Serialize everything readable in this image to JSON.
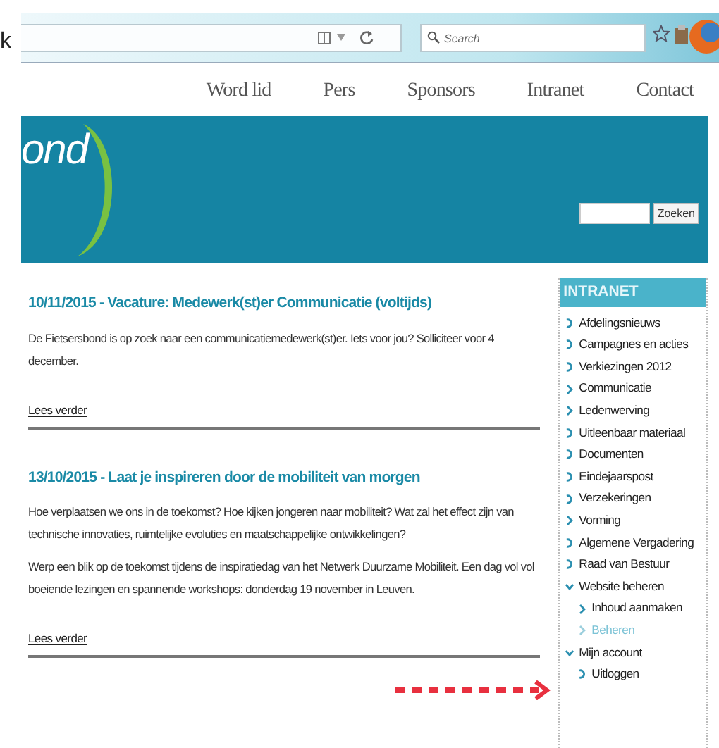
{
  "browser": {
    "edge_text": "k",
    "search": {
      "placeholder": "Search"
    }
  },
  "nav": [
    {
      "label": "Word lid"
    },
    {
      "label": "Pers"
    },
    {
      "label": "Sponsors"
    },
    {
      "label": "Intranet"
    },
    {
      "label": "Contact"
    }
  ],
  "header": {
    "logo_text": "ond",
    "search_button": "Zoeken"
  },
  "articles": [
    {
      "title": "10/11/2015 - Vacature: Medewerk(st)er Communicatie (voltijds)",
      "paragraphs": [
        " De Fietsersbond is op zoek naar een communicatiemedewerk(st)er. Iets voor jou? Solliciteer voor 4 december."
      ],
      "link": "Lees verder"
    },
    {
      "title": "13/10/2015 - Laat je inspireren door de mobiliteit van morgen",
      "paragraphs": [
        " Hoe verplaatsen we ons in de toekomst? Hoe kijken jongeren naar mobiliteit? Wat zal het effect zijn van technische innovaties, ruimtelijke evoluties en maatschappelijke ontwikkelingen?",
        "Werp een blik op de toekomst tijdens de inspiratiedag van het Netwerk Duurzame Mobiliteit. Een dag vol vol boeiende lezingen en spannende workshops: donderdag 19 november in Leuven."
      ],
      "link": "Lees verder"
    }
  ],
  "sidebar": {
    "title": "INTRANET",
    "items": [
      {
        "label": "Afdelingsnieuws",
        "kind": "link",
        "selected": false
      },
      {
        "label": "Campagnes en acties",
        "kind": "link",
        "selected": false
      },
      {
        "label": "Verkiezingen 2012",
        "kind": "link",
        "selected": false
      },
      {
        "label": "Communicatie",
        "kind": "folder",
        "expanded": false,
        "selected": false
      },
      {
        "label": "Ledenwerving",
        "kind": "folder",
        "expanded": false,
        "selected": false
      },
      {
        "label": "Uitleenbaar materiaal",
        "kind": "link",
        "selected": false
      },
      {
        "label": "Documenten",
        "kind": "link",
        "selected": false
      },
      {
        "label": "Eindejaarspost",
        "kind": "link",
        "selected": false
      },
      {
        "label": "Verzekeringen",
        "kind": "link",
        "selected": false
      },
      {
        "label": "Vorming",
        "kind": "folder",
        "expanded": false,
        "selected": false
      },
      {
        "label": "Algemene Vergadering",
        "kind": "link",
        "selected": false
      },
      {
        "label": "Raad van Bestuur",
        "kind": "link",
        "selected": false
      },
      {
        "label": "Website beheren",
        "kind": "folder",
        "expanded": true,
        "selected": false,
        "children": [
          {
            "label": "Inhoud aanmaken",
            "kind": "folder",
            "expanded": false,
            "selected": false
          },
          {
            "label": "Beheren",
            "kind": "folder",
            "expanded": false,
            "selected": true
          }
        ]
      },
      {
        "label": "Mijn account",
        "kind": "folder",
        "expanded": true,
        "selected": false,
        "children": [
          {
            "label": "Uitloggen",
            "kind": "link",
            "selected": false
          }
        ]
      }
    ]
  }
}
